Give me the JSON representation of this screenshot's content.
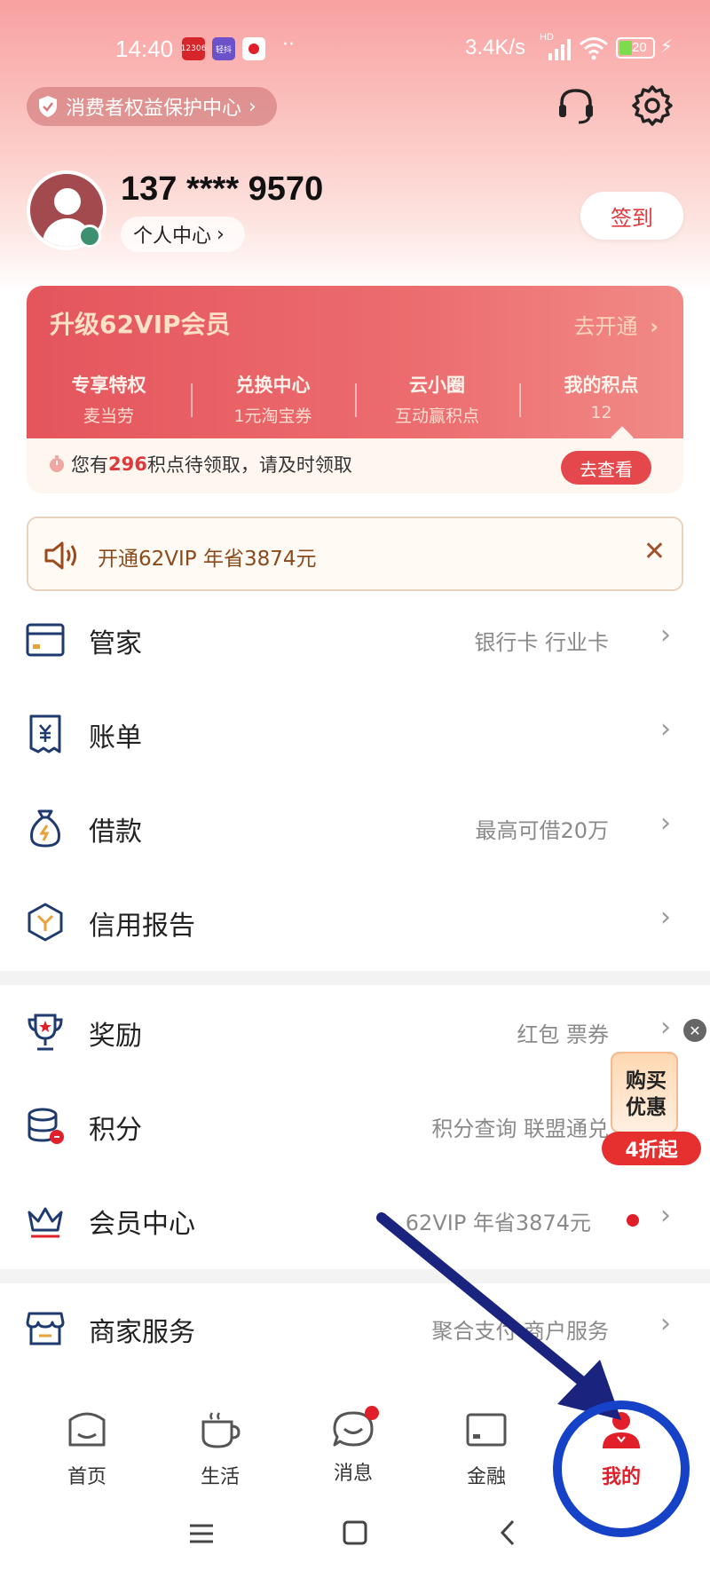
{
  "status_bar": {
    "time": "14:40",
    "app_icons": [
      "12306",
      "轻抖",
      "red-app"
    ],
    "net_speed": "3.4K/s",
    "network_badge": "HD",
    "battery": "20"
  },
  "header": {
    "consumer_protection": "消费者权益保护中心",
    "icons": [
      "headset-icon",
      "gear-icon"
    ]
  },
  "profile": {
    "phone": "137 **** 9570",
    "personal_center": "个人中心",
    "checkin": "签到"
  },
  "vip_card": {
    "title": "升级62VIP会员",
    "open_label": "去开通",
    "items": [
      {
        "title": "专享特权",
        "sub": "麦当劳"
      },
      {
        "title": "兑换中心",
        "sub": "1元淘宝券"
      },
      {
        "title": "云小圈",
        "sub": "互动赢积点"
      },
      {
        "title": "我的积点",
        "sub": "12"
      }
    ],
    "points_prefix": "您有",
    "points_value": "296",
    "points_suffix": "积点待领取，请及时领取",
    "go_button": "去查看"
  },
  "banner": {
    "text": "开通62VIP 年省3874元"
  },
  "menu_group1": [
    {
      "label": "管家",
      "right": "银行卡 行业卡",
      "icon": "card-icon"
    },
    {
      "label": "账单",
      "right": "",
      "icon": "bill-icon"
    },
    {
      "label": "借款",
      "right": "最高可借20万",
      "icon": "money-bag-icon"
    },
    {
      "label": "信用报告",
      "right": "",
      "icon": "credit-icon"
    }
  ],
  "menu_group2": [
    {
      "label": "奖励",
      "right": "红包 票券",
      "icon": "trophy-icon"
    },
    {
      "label": "积分",
      "right": "积分查询 联盟通兑",
      "icon": "coins-icon"
    },
    {
      "label": "会员中心",
      "right": "62VIP 年省3874元",
      "icon": "crown-icon"
    }
  ],
  "menu_group3": [
    {
      "label": "商家服务",
      "right": "聚合支付 商户服务",
      "icon": "store-icon"
    }
  ],
  "promo": {
    "line1": "购买",
    "line2": "优惠",
    "pill": "4折起"
  },
  "tabbar": [
    {
      "label": "首页",
      "icon": "home-icon"
    },
    {
      "label": "生活",
      "icon": "cup-icon"
    },
    {
      "label": "消息",
      "icon": "chat-icon"
    },
    {
      "label": "金融",
      "icon": "wallet-icon"
    },
    {
      "label": "我的",
      "icon": "user-icon",
      "active": true
    }
  ],
  "colors": {
    "accent": "#e11f2a",
    "vip": "#e4555c",
    "annotation_arrow": "#1a237e",
    "annotation_circle": "#1542c7"
  }
}
